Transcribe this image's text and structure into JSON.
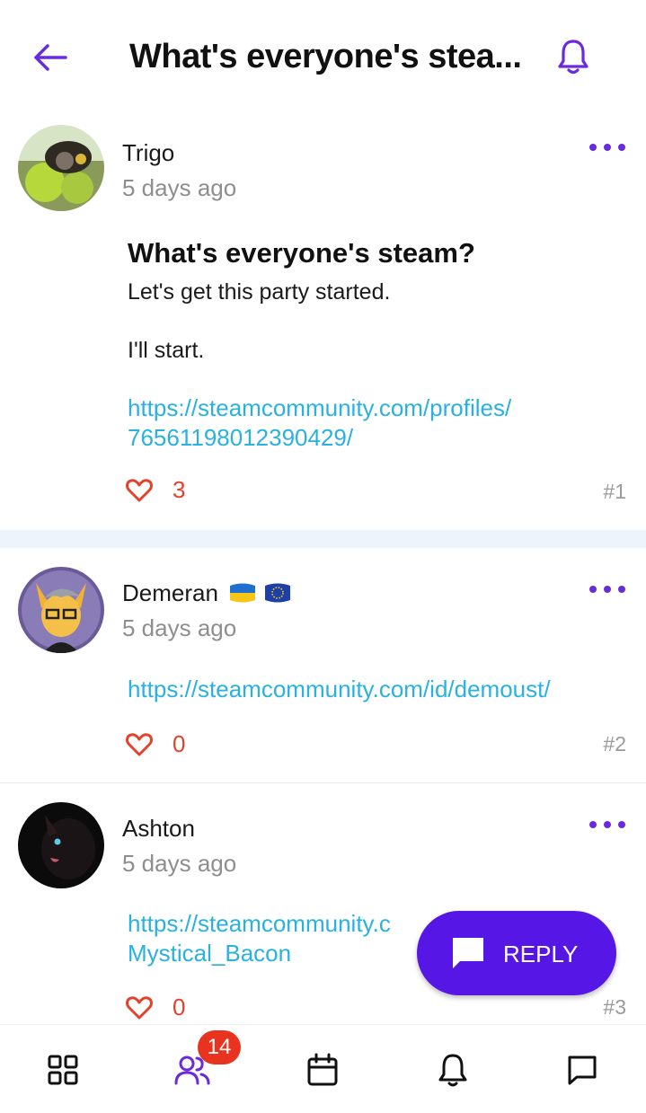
{
  "header": {
    "title": "What's everyone's stea...",
    "back_icon": "arrow-left-icon",
    "bell_icon": "bell-icon"
  },
  "posts": [
    {
      "username": "Trigo",
      "timestamp": "5 days ago",
      "title": "What's everyone's steam?",
      "body": [
        "Let's get this party started.",
        "I'll start."
      ],
      "link": [
        "https://steamcommunity.com/profiles/",
        "76561198012390429/"
      ],
      "likes": "3",
      "number": "#1"
    },
    {
      "username": "Demeran",
      "flags": [
        "ukraine-flag",
        "eu-flag"
      ],
      "timestamp": "5 days ago",
      "link": [
        "https://steamcommunity.com/id/demoust/"
      ],
      "likes": "0",
      "number": "#2"
    },
    {
      "username": "Ashton",
      "timestamp": "5 days ago",
      "link": [
        "https://steamcommunity.c",
        "Mystical_Bacon"
      ],
      "likes": "0",
      "number": "#3"
    }
  ],
  "reply_button": {
    "label": "REPLY"
  },
  "bottom_nav": {
    "items": [
      "grid-icon",
      "users-icon",
      "calendar-icon",
      "bell-icon",
      "chat-icon"
    ],
    "active": "users-icon",
    "badge": "14"
  },
  "colors": {
    "accent": "#6a2bdc",
    "reply_bg": "#5616e6",
    "link": "#29b1e0",
    "like": "#e2422c",
    "badge": "#e8331f"
  }
}
